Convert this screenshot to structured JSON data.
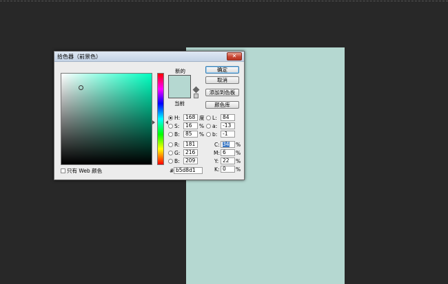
{
  "colors": {
    "canvas_bg": "#282828",
    "document": "#b5d8d1",
    "new_color": "#b5d8d1",
    "current_color": "#b5d8d1",
    "hue_base": "#00ffc0"
  },
  "dialog": {
    "title": "拾色器（前景色）",
    "close_glyph": "✕",
    "new_label": "新的",
    "current_label": "当前",
    "buttons": {
      "ok": "确定",
      "cancel": "取消",
      "add_swatch": "添加到色板",
      "libraries": "颜色库"
    },
    "hsb": {
      "h_label": "H:",
      "h_value": "168",
      "h_unit": "度",
      "s_label": "S:",
      "s_value": "16",
      "s_unit": "%",
      "b_label": "B:",
      "b_value": "85",
      "b_unit": "%"
    },
    "rgb": {
      "r_label": "R:",
      "r_value": "181",
      "g_label": "G:",
      "g_value": "216",
      "b_label": "B:",
      "b_value": "209"
    },
    "lab": {
      "l_label": "L:",
      "l_value": "84",
      "a_label": "a:",
      "a_value": "-13",
      "b_label": "b:",
      "b_value": "-1"
    },
    "cmyk": {
      "c_label": "C:",
      "c_value": "34",
      "m_label": "M:",
      "m_value": "6",
      "y_label": "Y:",
      "y_value": "22",
      "k_label": "K:",
      "k_value": "0",
      "unit": "%"
    },
    "hex": {
      "label": "#",
      "value": "b5d8d1"
    },
    "web_only_label": "只有 Web 颜色"
  }
}
